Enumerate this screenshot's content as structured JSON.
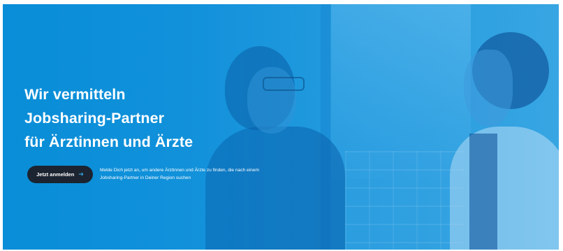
{
  "hero": {
    "headline": {
      "line1": "Wir vermitteln",
      "line2": "Jobsharing-Partner",
      "line3": "für Ärztinnen und Ärzte"
    },
    "cta": {
      "label": "Jetzt anmelden",
      "icon": "arrow-right-icon",
      "arrow_glyph": "➔"
    },
    "subtext": {
      "line1": "Melde Dich jetzt an, um andere Ärztinnen und Ärzte zu finden, die nach einem",
      "line2": "Jobsharing-Partner in Deiner Region suchen"
    }
  },
  "colors": {
    "hero_blue": "#1794dc",
    "cta_background": "#1b2430",
    "cta_arrow": "#3aa7e3",
    "text": "#ffffff"
  }
}
